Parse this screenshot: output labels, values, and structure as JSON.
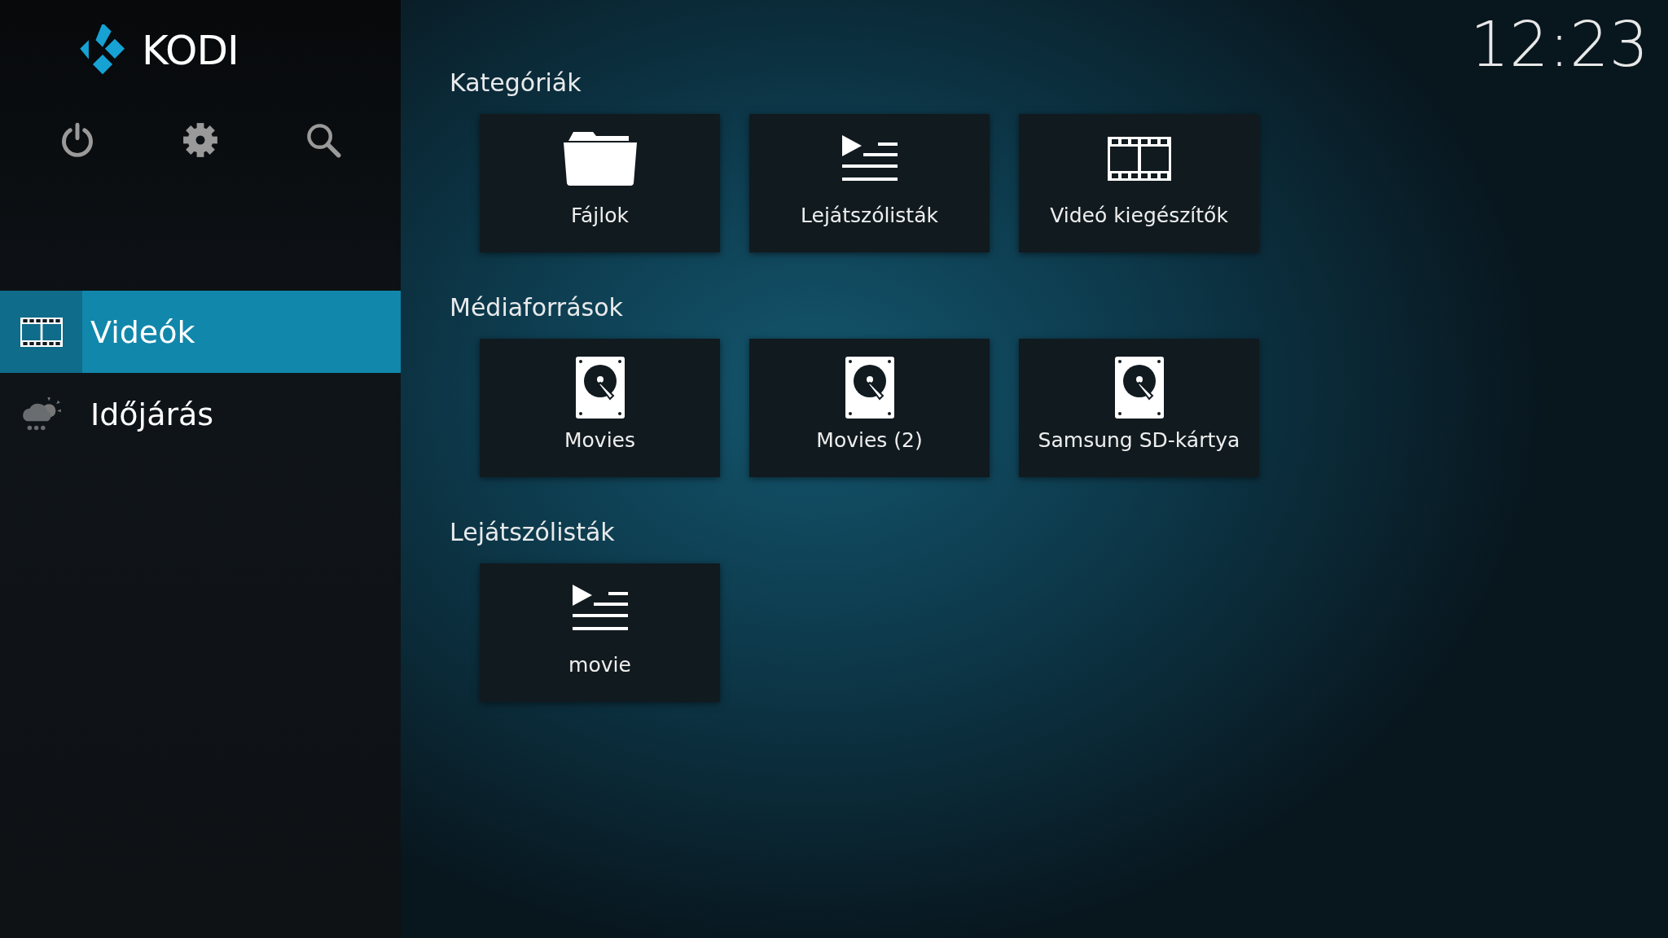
{
  "logo": {
    "text": "KODI"
  },
  "clock": "12:23",
  "sidebar": {
    "items": [
      {
        "label": "Videók",
        "kind": "film",
        "selected": true
      },
      {
        "label": "Időjárás",
        "kind": "weather",
        "selected": false
      }
    ]
  },
  "sections": [
    {
      "title": "Kategóriák",
      "tiles": [
        {
          "label": "Fájlok",
          "kind": "folder"
        },
        {
          "label": "Lejátszólisták",
          "kind": "playlist"
        },
        {
          "label": "Videó kiegészítők",
          "kind": "film"
        }
      ]
    },
    {
      "title": "Médiaforrások",
      "tiles": [
        {
          "label": "Movies",
          "kind": "drive"
        },
        {
          "label": "Movies (2)",
          "kind": "drive"
        },
        {
          "label": "Samsung SD-kártya",
          "kind": "drive"
        }
      ]
    },
    {
      "title": "Lejátszólisták",
      "tiles": [
        {
          "label": "movie",
          "kind": "playlist"
        }
      ]
    }
  ]
}
